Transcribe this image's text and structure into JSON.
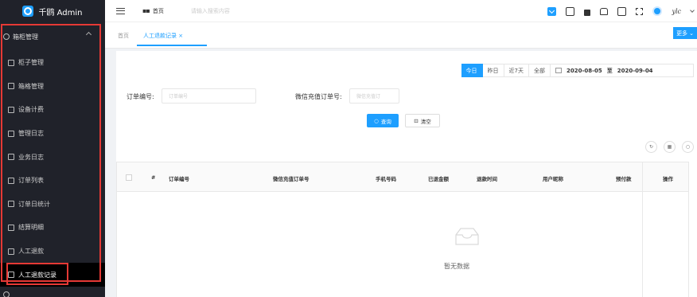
{
  "app": {
    "brand": "千鸥 Admin"
  },
  "sidebar": {
    "group": {
      "label": "箱柜管理"
    },
    "items": [
      {
        "label": "柜子管理"
      },
      {
        "label": "箱格管理"
      },
      {
        "label": "设备计费"
      },
      {
        "label": "管理日志"
      },
      {
        "label": "业务日志"
      },
      {
        "label": "订单列表"
      },
      {
        "label": "订单日统计"
      },
      {
        "label": "结算明细"
      },
      {
        "label": "人工退款"
      },
      {
        "label": "人工退款记录"
      }
    ]
  },
  "topbar": {
    "crumb": "首页",
    "search_placeholder": "请输入搜索内容",
    "user": "ylc"
  },
  "tabs": {
    "home": "首页",
    "active": "人工退款记录 ×",
    "more": "更多"
  },
  "filters": {
    "range": [
      "今日",
      "昨日",
      "近7天",
      "全部"
    ],
    "date_from": "2020-08-05",
    "date_sep": "至",
    "date_to": "2020-09-04",
    "order_label": "订单编号:",
    "order_placeholder": "订单编号",
    "wx_label": "微信充值订单号:",
    "wx_placeholder": "微信充值订",
    "query": "查询",
    "clear": "清空"
  },
  "table": {
    "columns": [
      "#",
      "订单编号",
      "微信充值订单号",
      "手机号码",
      "已退金额",
      "退款时间",
      "用户昵称",
      "预付款",
      "操作"
    ],
    "empty": "暂无数据"
  }
}
